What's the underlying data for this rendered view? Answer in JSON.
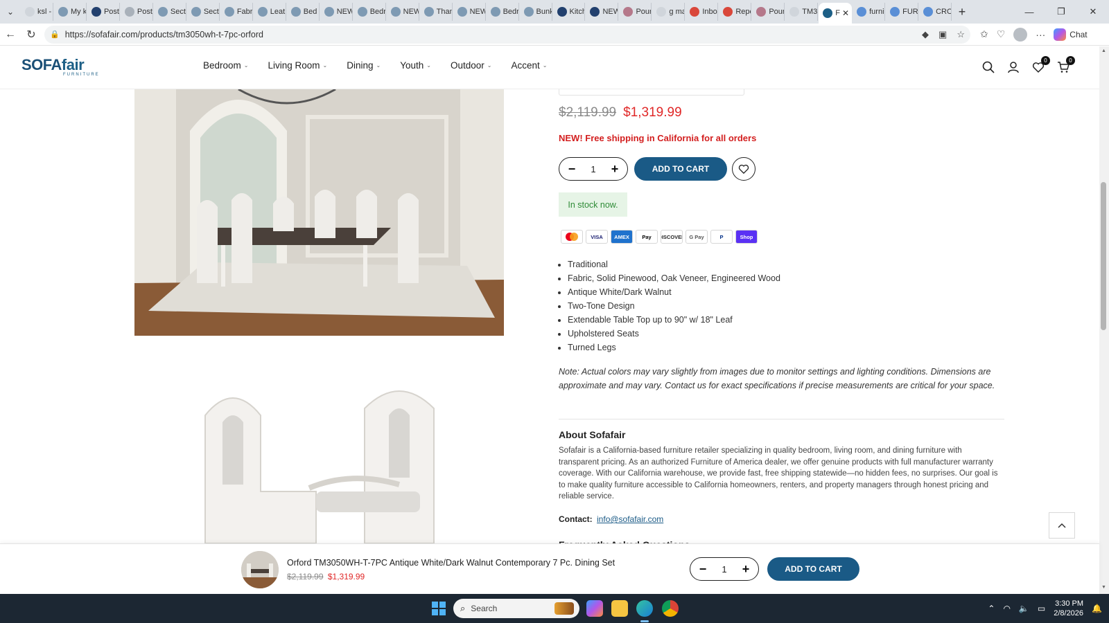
{
  "browser": {
    "tabs": [
      {
        "label": "ksl -",
        "color": "#d0d5db"
      },
      {
        "label": "My k",
        "color": "#7e9ab3"
      },
      {
        "label": "Post",
        "color": "#22406e"
      },
      {
        "label": "Post",
        "color": "#a9b1ba"
      },
      {
        "label": "Secti",
        "color": "#7e9ab3"
      },
      {
        "label": "Secti",
        "color": "#7e9ab3"
      },
      {
        "label": "Fabri",
        "color": "#7e9ab3"
      },
      {
        "label": "Leatl",
        "color": "#7e9ab3"
      },
      {
        "label": "Bed I",
        "color": "#7e9ab3"
      },
      {
        "label": "NEW",
        "color": "#7e9ab3"
      },
      {
        "label": "Bedr",
        "color": "#7e9ab3"
      },
      {
        "label": "NEW",
        "color": "#7e9ab3"
      },
      {
        "label": "Than",
        "color": "#7e9ab3"
      },
      {
        "label": "NEW",
        "color": "#7e9ab3"
      },
      {
        "label": "Bedr",
        "color": "#7e9ab3"
      },
      {
        "label": "Bunk",
        "color": "#7e9ab3"
      },
      {
        "label": "Kitch",
        "color": "#22406e"
      },
      {
        "label": "NEW",
        "color": "#22406e"
      },
      {
        "label": "Pour",
        "color": "#b5788a"
      },
      {
        "label": "g ma",
        "color": "#d0d5db"
      },
      {
        "label": "Inbo",
        "color": "#d9473a"
      },
      {
        "label": "Repc",
        "color": "#d9473a"
      },
      {
        "label": "Pour",
        "color": "#b5788a"
      },
      {
        "label": "TM3",
        "color": "#d0d5db"
      }
    ],
    "active_tab": {
      "label": "F",
      "color": "#1d5f86"
    },
    "tabs_after": [
      {
        "label": "furni",
        "color": "#5a8fd6"
      },
      {
        "label": "FURI",
        "color": "#5a8fd6"
      },
      {
        "label": "CRO",
        "color": "#5a8fd6"
      }
    ],
    "url": "https://sofafair.com/products/tm3050wh-t-7pc-orford",
    "chat_label": "Chat"
  },
  "site": {
    "logo_main_a": "SOFA",
    "logo_main_b": "fair",
    "logo_sub": "FURNITURE",
    "nav": [
      "Bedroom",
      "Living Room",
      "Dining",
      "Youth",
      "Outdoor",
      "Accent"
    ],
    "wishlist_count": "0",
    "cart_count": "0"
  },
  "product": {
    "price_old": "$2,119.99",
    "price_new": "$1,319.99",
    "shipping_note": "NEW! Free shipping in California for all orders",
    "quantity": "1",
    "add_to_cart": "ADD TO CART",
    "stock_status": "In stock now.",
    "payment_methods": [
      {
        "name": "mastercard",
        "label": "",
        "bg": "#ffffff",
        "fg": "#000"
      },
      {
        "name": "visa",
        "label": "VISA",
        "bg": "#ffffff",
        "fg": "#1a1f71"
      },
      {
        "name": "amex",
        "label": "AMEX",
        "bg": "#1f72cd",
        "fg": "#ffffff"
      },
      {
        "name": "apple-pay",
        "label": "Pay",
        "bg": "#ffffff",
        "fg": "#000"
      },
      {
        "name": "discover",
        "label": "DISCOVER",
        "bg": "#ffffff",
        "fg": "#222"
      },
      {
        "name": "google-pay",
        "label": "G Pay",
        "bg": "#ffffff",
        "fg": "#555"
      },
      {
        "name": "paypal",
        "label": "P",
        "bg": "#ffffff",
        "fg": "#003087"
      },
      {
        "name": "shop-pay",
        "label": "Shop",
        "bg": "#5a31f4",
        "fg": "#ffffff"
      }
    ],
    "features": [
      "Traditional",
      "Fabric, Solid Pinewood, Oak Veneer, Engineered Wood",
      "Antique White/Dark Walnut",
      "Two-Tone Design",
      "Extendable Table Top up to 90\" w/ 18\" Leaf",
      "Upholstered Seats",
      "Turned Legs"
    ],
    "note": "Note: Actual colors may vary slightly from images due to monitor settings and lighting conditions. Dimensions are approximate and may vary. Contact us for exact specifications if precise measurements are critical for your space.",
    "about_title": "About Sofafair",
    "about_text": "Sofafair is a California-based furniture retailer specializing in quality bedroom, living room, and dining furniture with transparent pricing. As an authorized Furniture of America dealer, we offer genuine products with full manufacturer warranty coverage. With our California warehouse, we provide fast, free shipping statewide—no hidden fees, no surprises. Our goal is to make quality furniture accessible to California homeowners, renters, and property managers through honest pricing and reliable service.",
    "contact_label": "Contact:",
    "contact_email": "info@sofafair.com",
    "faq_title": "Frequently Asked Questions"
  },
  "sticky_bar": {
    "title": "Orford TM3050WH-T-7PC Antique White/Dark Walnut Contemporary 7 Pc. Dining Set",
    "price_old": "$2,119.99",
    "price_new": "$1,319.99",
    "quantity": "1",
    "add_to_cart": "ADD TO CART"
  },
  "taskbar": {
    "search_placeholder": "Search",
    "time": "3:30 PM",
    "date": "2/8/2026"
  },
  "colors": {
    "brand_blue": "#1a5a86",
    "sale_red": "#e02727",
    "stock_green": "#2e8b36"
  }
}
